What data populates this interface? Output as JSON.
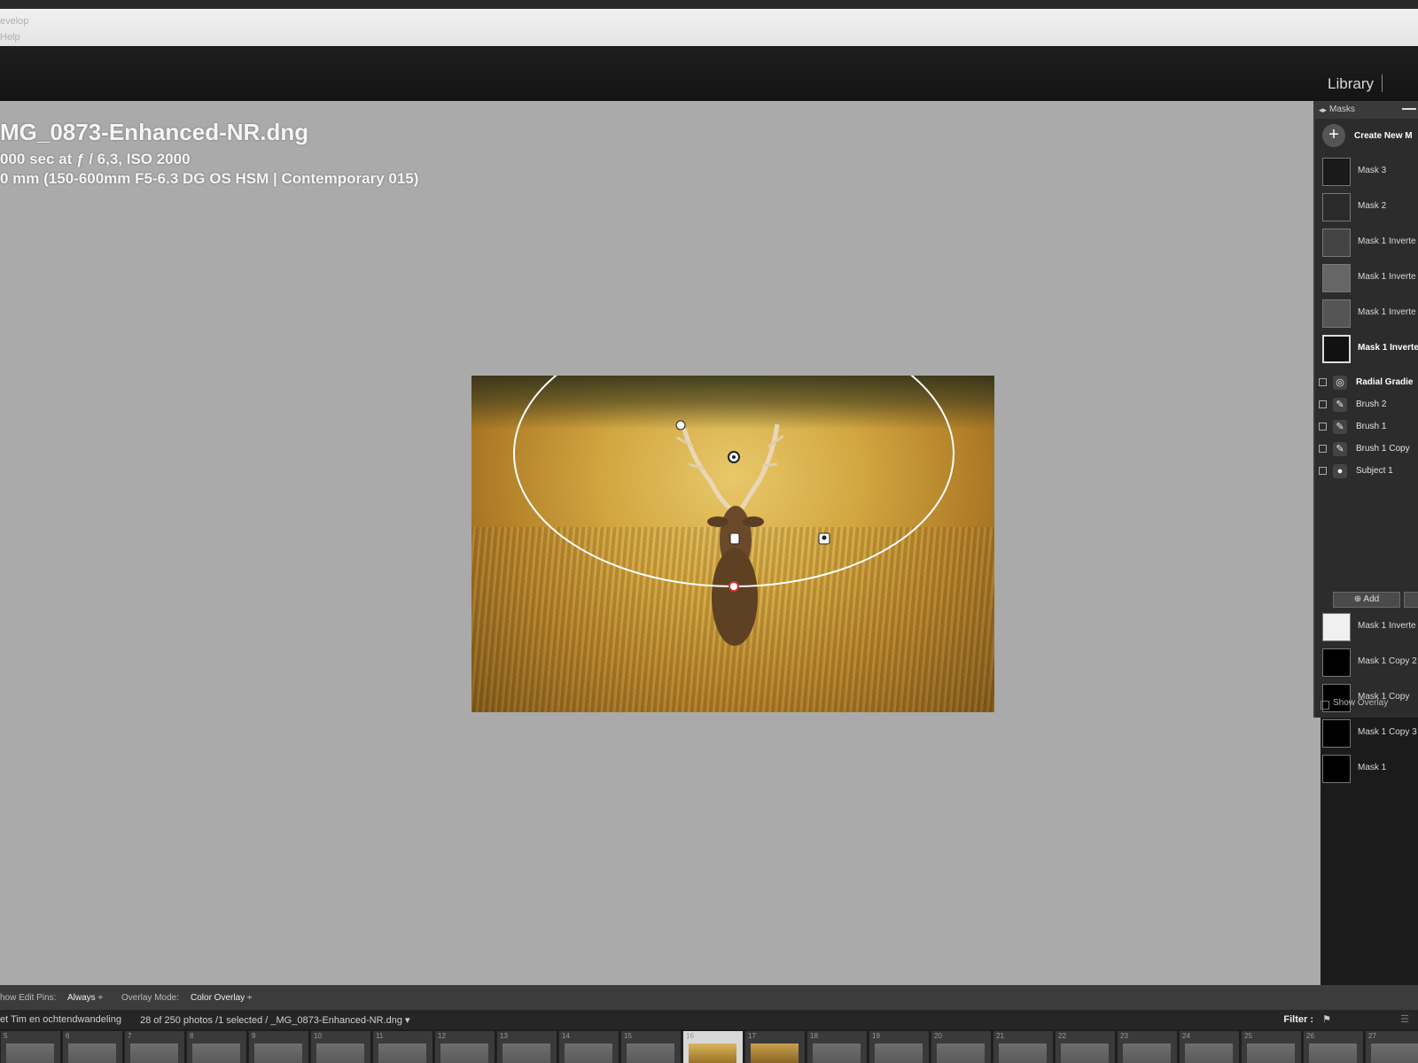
{
  "menu": {
    "develop": "evelop",
    "help": "Help"
  },
  "modules": {
    "library": "Library"
  },
  "photo_info": {
    "filename": "MG_0873-Enhanced-NR.dng",
    "exposure": "000 sec at ƒ / 6,3, ISO 2000",
    "lens": "0 mm (150-600mm F5-6.3 DG OS HSM | Contemporary 015)"
  },
  "masks_panel": {
    "title": "Masks",
    "create_new": "Create New M",
    "masks_top": [
      {
        "label": "Mask 3",
        "thumb": "#1a1a1a"
      },
      {
        "label": "Mask 2",
        "thumb": "#2a2a2a"
      },
      {
        "label": "Mask 1 Inverte",
        "thumb": "#444"
      },
      {
        "label": "Mask 1 Inverte",
        "thumb": "#666"
      },
      {
        "label": "Mask 1 Inverte",
        "thumb": "#555"
      },
      {
        "label": "Mask 1 Inverte",
        "thumb": "#111"
      }
    ],
    "components": [
      {
        "label": "Radial Gradie",
        "icon": "◎"
      },
      {
        "label": "Brush 2",
        "icon": "✎"
      },
      {
        "label": "Brush 1",
        "icon": "✎"
      },
      {
        "label": "Brush 1 Copy",
        "icon": "✎"
      },
      {
        "label": "Subject 1",
        "icon": "●"
      }
    ],
    "add_label": "Add",
    "masks_bottom": [
      {
        "label": "Mask 1 Inverte",
        "thumb": "#f0f0f0"
      },
      {
        "label": "Mask 1 Copy 2",
        "thumb": "#000"
      },
      {
        "label": "Mask 1 Copy",
        "thumb": "#000"
      },
      {
        "label": "Mask 1 Copy 3",
        "thumb": "#000"
      },
      {
        "label": "Mask 1",
        "thumb": "#000"
      }
    ],
    "show_overlay": "Show Overlay"
  },
  "toolbar": {
    "show_edit_pins_label": "how Edit Pins:",
    "show_edit_pins_value": "Always ÷",
    "overlay_mode_label": "Overlay Mode:",
    "overlay_mode_value": "Color Overlay ÷"
  },
  "filmstrip_header": {
    "collection": "et Tim en ochtendwandeling",
    "status": "28 of 250 photos /1 selected / _MG_0873-Enhanced-NR.dng ▾",
    "filter_label": "Filter :"
  },
  "filmstrip": {
    "frame_numbers": [
      "5",
      "6",
      "7",
      "8",
      "9",
      "10",
      "11",
      "12",
      "13",
      "14",
      "15",
      "16",
      "17",
      "18",
      "19",
      "20",
      "21",
      "22",
      "23",
      "24",
      "25",
      "26",
      "27"
    ],
    "selected_frame": "16"
  },
  "colors": {
    "canvas_bg": "#a9aaa9",
    "panel_bg": "#2c2c2c",
    "radial_line": "#ffffff"
  }
}
